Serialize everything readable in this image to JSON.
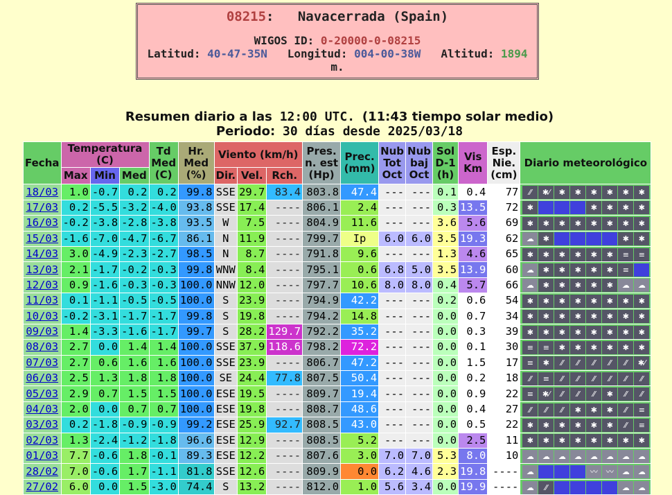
{
  "station": {
    "code": "08215",
    "name": "Navacerrada (Spain)",
    "wigos_label": "WIGOS ID:",
    "wigos_id": "0-20000-0-08215",
    "lat_label": "Latitud:",
    "lat": "40-47-35N",
    "lon_label": "Longitud:",
    "lon": "004-00-38W",
    "alt_label": "Altitud:",
    "alt": "1894",
    "alt_unit": "m."
  },
  "summary": {
    "line1_a": "Resumen diario a las",
    "line1_time": "12:00 UTC.",
    "line1_b": "(11:43 tiempo solar medio)",
    "line2_a": "Periodo:",
    "line2_b": "30 días desde 2025/03/18"
  },
  "headers": {
    "fecha": "Fecha",
    "temperatura": "Temperatura (C)",
    "max": "Max",
    "min": "Min",
    "med": "Med",
    "td": "Td Med (C)",
    "hr": "Hr. Med (%)",
    "viento": "Viento (km/h)",
    "dir": "Dir.",
    "vel": "Vel.",
    "rch": "Rch.",
    "pres": "Pres. n. est (Hp)",
    "prec": "Prec. (mm)",
    "nubtot": "Nub Tot Oct",
    "nubbaj": "Nub baj Oct",
    "sol": "Sol D-1 (h)",
    "vis": "Vis Km",
    "esp": "Esp. Nie. (cm)",
    "diario": "Diario meteorológico"
  },
  "colors": {
    "temp_cyan": "#33dddd",
    "temp_green": "#66ee66",
    "temp_lgreen": "#99ee66",
    "hr_blue": "#3399ff",
    "hr_lblue": "#66bbee",
    "hr_cyan": "#33cccc",
    "vel_green": "#88ee55",
    "rch_magenta": "#cc33cc",
    "rch_blue": "#33bbff",
    "prec_blue": "#3399ff",
    "prec_green": "#99ee55",
    "prec_magenta": "#dd22dd",
    "prec_orange": "#ff8833",
    "prec_yellow": "#eeff88",
    "sol_yellow": "#ffff99",
    "sol_lgreen": "#bbffbb",
    "vis_blue": "#7777ee",
    "vis_white": "#ffffff",
    "vis_purple": "#bb88ee"
  },
  "rows": [
    {
      "fecha": "18/03",
      "max": "1.0",
      "min": "-0.7",
      "med": "0.2",
      "td": "0.2",
      "hr": "99.8",
      "dir": "SSE",
      "vel": "29.7",
      "rch": "83.4",
      "pres": "803.8",
      "prec": "47.4",
      "nt": "---",
      "nb": "---",
      "sol": "0.1",
      "vis": "0.4",
      "esp": "77",
      "icons": [
        "rain",
        "snow-rain",
        "snow",
        "snow",
        "snow",
        "snow",
        "snow",
        "snow"
      ]
    },
    {
      "fecha": "17/03",
      "max": "0.2",
      "min": "-5.5",
      "med": "-3.2",
      "td": "-4.0",
      "hr": "93.8",
      "dir": "SSE",
      "vel": "17.4",
      "rch": "----",
      "pres": "806.1",
      "prec": "2.4",
      "nt": "---",
      "nb": "---",
      "sol": "0.3",
      "vis": "13.5",
      "esp": "72",
      "icons": [
        "snow",
        "blank",
        "blank",
        "blank",
        "snow",
        "snow",
        "snow",
        "snow"
      ]
    },
    {
      "fecha": "16/03",
      "max": "-0.2",
      "min": "-3.8",
      "med": "-2.8",
      "td": "-3.8",
      "hr": "93.5",
      "dir": "W",
      "vel": "7.5",
      "rch": "----",
      "pres": "804.9",
      "prec": "11.6",
      "nt": "---",
      "nb": "---",
      "sol": "3.6",
      "vis": "5.6",
      "esp": "69",
      "icons": [
        "snow",
        "snow",
        "snow",
        "snow",
        "snow",
        "snow",
        "snow",
        "snow"
      ]
    },
    {
      "fecha": "15/03",
      "max": "-1.6",
      "min": "-7.0",
      "med": "-4.7",
      "td": "-6.7",
      "hr": "86.1",
      "dir": "N",
      "vel": "11.9",
      "rch": "----",
      "pres": "799.7",
      "prec": "Ip",
      "nt": "6.0",
      "nb": "6.0",
      "sol": "3.5",
      "vis": "19.3",
      "esp": "62",
      "icons": [
        "cloud",
        "snow",
        "blank",
        "blank",
        "blank",
        "blank",
        "snow",
        "snow"
      ]
    },
    {
      "fecha": "14/03",
      "max": "3.0",
      "min": "-4.9",
      "med": "-2.3",
      "td": "-2.7",
      "hr": "98.5",
      "dir": "N",
      "vel": "8.7",
      "rch": "----",
      "pres": "791.8",
      "prec": "9.6",
      "nt": "---",
      "nb": "---",
      "sol": "1.3",
      "vis": "4.6",
      "esp": "65",
      "icons": [
        "snow",
        "snow",
        "snow",
        "snow",
        "snow",
        "snow",
        "fog",
        "fog"
      ]
    },
    {
      "fecha": "13/03",
      "max": "2.1",
      "min": "-1.7",
      "med": "-0.2",
      "td": "-0.3",
      "hr": "99.8",
      "dir": "WNW",
      "vel": "8.4",
      "rch": "----",
      "pres": "795.1",
      "prec": "0.6",
      "nt": "6.8",
      "nb": "5.0",
      "sol": "3.5",
      "vis": "13.9",
      "esp": "60",
      "icons": [
        "cloud",
        "snow",
        "snow",
        "snow",
        "snow",
        "snow",
        "fog",
        "blank"
      ]
    },
    {
      "fecha": "12/03",
      "max": "0.9",
      "min": "-1.6",
      "med": "-0.3",
      "td": "-0.3",
      "hr": "100.0",
      "dir": "NNW",
      "vel": "12.0",
      "rch": "----",
      "pres": "797.7",
      "prec": "10.6",
      "nt": "8.0",
      "nb": "8.0",
      "sol": "0.4",
      "vis": "5.7",
      "esp": "66",
      "icons": [
        "cloud",
        "snow",
        "snow",
        "snow",
        "snow",
        "snow",
        "cloud",
        "cloud"
      ]
    },
    {
      "fecha": "11/03",
      "max": "0.1",
      "min": "-1.1",
      "med": "-0.5",
      "td": "-0.5",
      "hr": "100.0",
      "dir": "S",
      "vel": "23.9",
      "rch": "----",
      "pres": "794.9",
      "prec": "42.2",
      "nt": "---",
      "nb": "---",
      "sol": "0.2",
      "vis": "0.6",
      "esp": "54",
      "icons": [
        "snow",
        "snow",
        "snow",
        "snow",
        "snow",
        "snow",
        "snow",
        "snow"
      ]
    },
    {
      "fecha": "10/03",
      "max": "-0.2",
      "min": "-3.1",
      "med": "-1.7",
      "td": "-1.7",
      "hr": "99.8",
      "dir": "S",
      "vel": "19.8",
      "rch": "----",
      "pres": "794.2",
      "prec": "14.8",
      "nt": "---",
      "nb": "---",
      "sol": "0.0",
      "vis": "0.7",
      "esp": "34",
      "icons": [
        "snow",
        "snow",
        "snow",
        "snow",
        "snow",
        "snow",
        "snow",
        "snow"
      ]
    },
    {
      "fecha": "09/03",
      "max": "1.4",
      "min": "-3.3",
      "med": "-1.6",
      "td": "-1.7",
      "hr": "99.7",
      "dir": "S",
      "vel": "28.2",
      "rch": "129.7",
      "pres": "792.2",
      "prec": "35.2",
      "nt": "---",
      "nb": "---",
      "sol": "0.0",
      "vis": "0.3",
      "esp": "39",
      "icons": [
        "snow",
        "snow",
        "snow",
        "snow",
        "snow",
        "snow",
        "snow",
        "snow"
      ]
    },
    {
      "fecha": "08/03",
      "max": "2.7",
      "min": "0.0",
      "med": "1.4",
      "td": "1.4",
      "hr": "100.0",
      "dir": "SSE",
      "vel": "37.9",
      "rch": "118.6",
      "pres": "798.2",
      "prec": "72.2",
      "nt": "---",
      "nb": "---",
      "sol": "0.0",
      "vis": "0.1",
      "esp": "30",
      "icons": [
        "fog",
        "fog",
        "snow",
        "snow",
        "snow",
        "snow",
        "snow",
        "snow"
      ]
    },
    {
      "fecha": "07/03",
      "max": "2.7",
      "min": "0.6",
      "med": "1.6",
      "td": "1.6",
      "hr": "100.0",
      "dir": "SSE",
      "vel": "23.9",
      "rch": "----",
      "pres": "806.7",
      "prec": "47.2",
      "nt": "---",
      "nb": "---",
      "sol": "0.0",
      "vis": "1.5",
      "esp": "17",
      "icons": [
        "fog",
        "snow",
        "rain",
        "rain",
        "rain",
        "rain",
        "rain",
        "snow-rain"
      ]
    },
    {
      "fecha": "06/03",
      "max": "2.5",
      "min": "1.3",
      "med": "1.8",
      "td": "1.8",
      "hr": "100.0",
      "dir": "SE",
      "vel": "24.4",
      "rch": "77.8",
      "pres": "807.5",
      "prec": "50.4",
      "nt": "---",
      "nb": "---",
      "sol": "0.0",
      "vis": "0.2",
      "esp": "18",
      "icons": [
        "rain",
        "fog",
        "rain",
        "rain",
        "rain",
        "rain",
        "rain",
        "rain"
      ]
    },
    {
      "fecha": "05/03",
      "max": "2.9",
      "min": "0.7",
      "med": "1.5",
      "td": "1.5",
      "hr": "100.0",
      "dir": "ESE",
      "vel": "19.5",
      "rch": "----",
      "pres": "809.7",
      "prec": "19.4",
      "nt": "---",
      "nb": "---",
      "sol": "0.0",
      "vis": "0.9",
      "esp": "22",
      "icons": [
        "fog",
        "snow-rain",
        "rain",
        "rain",
        "rain",
        "snow",
        "rain",
        "rain"
      ]
    },
    {
      "fecha": "04/03",
      "max": "2.0",
      "min": "0.0",
      "med": "0.7",
      "td": "0.7",
      "hr": "100.0",
      "dir": "ESE",
      "vel": "19.8",
      "rch": "----",
      "pres": "808.7",
      "prec": "48.6",
      "nt": "---",
      "nb": "---",
      "sol": "0.0",
      "vis": "0.4",
      "esp": "27",
      "icons": [
        "rain",
        "rain",
        "rain",
        "snow",
        "snow",
        "snow",
        "rain",
        "fog"
      ]
    },
    {
      "fecha": "03/03",
      "max": "0.2",
      "min": "-1.8",
      "med": "-0.9",
      "td": "-0.9",
      "hr": "99.2",
      "dir": "ESE",
      "vel": "25.9",
      "rch": "92.7",
      "pres": "808.5",
      "prec": "43.0",
      "nt": "---",
      "nb": "---",
      "sol": "0.0",
      "vis": "0.5",
      "esp": "22",
      "icons": [
        "snow",
        "snow",
        "snow",
        "snow",
        "snow",
        "snow",
        "rain",
        "fog"
      ]
    },
    {
      "fecha": "02/03",
      "max": "1.3",
      "min": "-2.4",
      "med": "-1.2",
      "td": "-1.8",
      "hr": "96.6",
      "dir": "ESE",
      "vel": "12.9",
      "rch": "----",
      "pres": "808.5",
      "prec": "5.2",
      "nt": "---",
      "nb": "---",
      "sol": "0.0",
      "vis": "2.5",
      "esp": "11",
      "icons": [
        "snow",
        "snow",
        "snow",
        "snow",
        "snow",
        "snow",
        "snow",
        "snow"
      ]
    },
    {
      "fecha": "01/03",
      "max": "7.7",
      "min": "-0.6",
      "med": "1.8",
      "td": "-0.1",
      "hr": "89.3",
      "dir": "ESE",
      "vel": "12.2",
      "rch": "----",
      "pres": "807.6",
      "prec": "3.0",
      "nt": "7.0",
      "nb": "7.0",
      "sol": "5.3",
      "vis": "8.0",
      "esp": "10",
      "icons": [
        "cloud",
        "cloud",
        "cloud",
        "cloud",
        "cloud",
        "cloud",
        "cloud",
        "cloud"
      ]
    },
    {
      "fecha": "28/02",
      "max": "7.0",
      "min": "-0.6",
      "med": "1.7",
      "td": "-1.1",
      "hr": "81.8",
      "dir": "SSE",
      "vel": "12.6",
      "rch": "----",
      "pres": "809.9",
      "prec": "0.0",
      "nt": "6.2",
      "nb": "4.6",
      "sol": "2.3",
      "vis": "19.8",
      "esp": "----",
      "icons": [
        "cloud",
        "blank",
        "blank",
        "blank",
        "wind",
        "wind",
        "cloud",
        "cloud"
      ]
    },
    {
      "fecha": "27/02",
      "max": "6.0",
      "min": "0.0",
      "med": "1.5",
      "td": "-3.0",
      "hr": "74.4",
      "dir": "S",
      "vel": "13.2",
      "rch": "----",
      "pres": "812.0",
      "prec": "1.0",
      "nt": "5.6",
      "nb": "3.4",
      "sol": "0.0",
      "vis": "19.9",
      "esp": "----",
      "icons": [
        "cloud",
        "rain",
        "blank",
        "blank",
        "blank",
        "blank",
        "cloud",
        "cloud"
      ]
    }
  ]
}
